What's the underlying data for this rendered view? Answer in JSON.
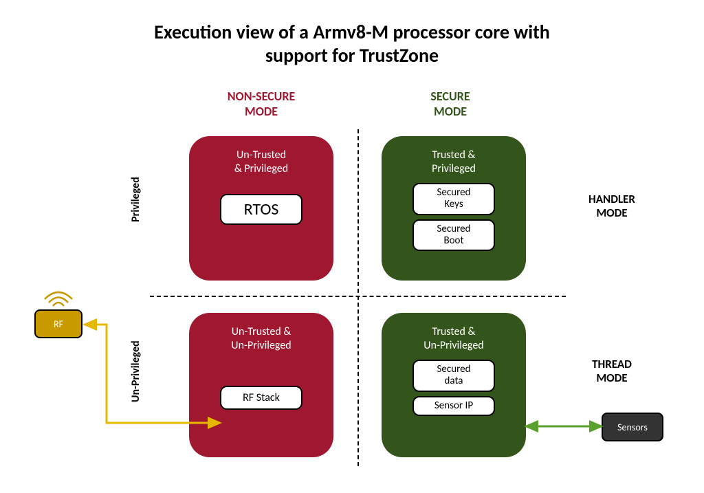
{
  "title_line1": "Execution view of a Armv8-M processor core with",
  "title_line2": "support for TrustZone",
  "columns": {
    "nonsecure": "NON-SECURE\nMODE",
    "secure": "SECURE\nMODE"
  },
  "rows_right": {
    "handler": "HANDLER\nMODE",
    "thread": "THREAD\nMODE"
  },
  "rows_left": {
    "privileged": "Privileged",
    "unprivileged": "Un-Privileged"
  },
  "quadrants": {
    "q1": {
      "header": "Un-Trusted\n& Privileged",
      "pill_big": "RTOS"
    },
    "q2": {
      "header": "Trusted &\nPrivileged",
      "pill_a": "Secured\nKeys",
      "pill_b": "Secured\nBoot"
    },
    "q3": {
      "header": "Un-Trusted &\nUn-Privileged",
      "pill_med": "RF Stack"
    },
    "q4": {
      "header": "Trusted &\nUn-Privileged",
      "pill_a": "Secured\ndata",
      "pill_b": "Sensor IP"
    }
  },
  "external": {
    "rf": "RF",
    "sensors": "Sensors"
  },
  "colors": {
    "red": "#a01830",
    "green": "#33551b",
    "gold": "#c89a00",
    "sensor_green": "#5aa02c"
  }
}
